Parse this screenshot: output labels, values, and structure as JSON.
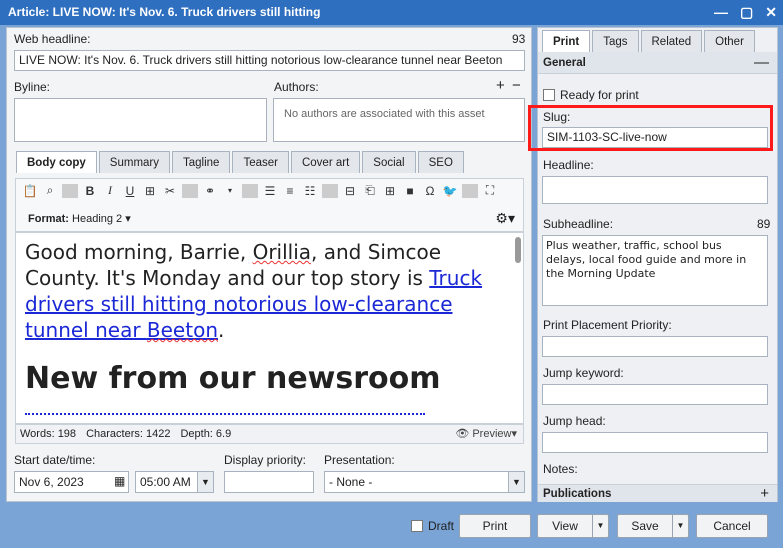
{
  "window": {
    "title": "Article: LIVE NOW: It's Nov. 6. Truck drivers still hitting",
    "controls": [
      "—",
      "▢",
      "✕"
    ]
  },
  "web_headline": {
    "label": "Web headline:",
    "count": "93",
    "value": "LIVE NOW: It's Nov. 6. Truck drivers still hitting notorious low-clearance tunnel near Beeton"
  },
  "byline": {
    "label": "Byline:"
  },
  "authors": {
    "label": "Authors:",
    "add": "+",
    "remove": "−",
    "empty": "No authors are associated with this asset"
  },
  "content_tabs": [
    "Body copy",
    "Summary",
    "Tagline",
    "Teaser",
    "Cover art",
    "Social",
    "SEO"
  ],
  "format": {
    "label": "Format:",
    "value": "Heading 2"
  },
  "editor": {
    "text_before": "Good morning, Barrie, ",
    "orillia": "Orillia",
    "text_mid": ", and Simcoe County. It's Monday and our top story is ",
    "link_a": "Truck drivers still hitting notorious low-clearance tunnel near ",
    "link_b": "Beeton",
    "text_end": ".",
    "heading": "New from our newsroom"
  },
  "status": {
    "words": "Words: 198",
    "characters": "Characters: 1422",
    "depth": "Depth: 6.9",
    "preview": "Preview"
  },
  "start_date": {
    "label": "Start date/time:",
    "date": "Nov 6, 2023",
    "time": "05:00 AM"
  },
  "display_priority": {
    "label": "Display priority:"
  },
  "presentation": {
    "label": "Presentation:",
    "value": "- None -"
  },
  "right_tabs": [
    "Print",
    "Tags",
    "Related",
    "Other"
  ],
  "general": {
    "title": "General",
    "collapse": "—"
  },
  "ready_for_print": "Ready for print",
  "slug": {
    "label": "Slug:",
    "value": "SIM-1103-SC-live-now"
  },
  "headline": {
    "label": "Headline:"
  },
  "subheadline": {
    "label": "Subheadline:",
    "count": "89",
    "value": "Plus weather, traffic, school bus delays, local food guide and more in the Morning Update"
  },
  "print_placement": {
    "label": "Print Placement Priority:"
  },
  "jump_keyword": {
    "label": "Jump keyword:"
  },
  "jump_head": {
    "label": "Jump head:"
  },
  "notes": {
    "label": "Notes:"
  },
  "publications": {
    "title": "Publications",
    "add": "+"
  },
  "footer": {
    "draft": "Draft",
    "print": "Print",
    "view": "View",
    "save": "Save",
    "cancel": "Cancel"
  },
  "colors": {
    "title_bar": "#2f6fbf",
    "link": "#1b28d6",
    "highlight": "#ff1a1a"
  }
}
